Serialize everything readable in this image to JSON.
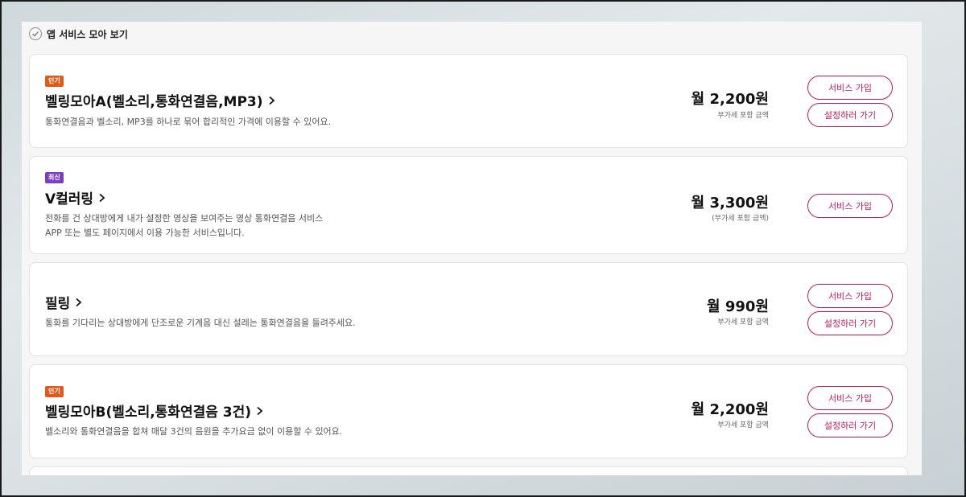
{
  "section": {
    "title": "앱 서비스 모아 보기"
  },
  "cards": [
    {
      "badge": "인기",
      "title": "벨링모아A(벨소리,통화연결음,MP3)",
      "desc1": "통화연결음과 벨소리, MP3를 하나로 묶어 합리적인 가격에 이용할 수 있어요.",
      "price": "월 2,200원",
      "vat": "부가세 포함 금액",
      "join_label": "서비스 가입",
      "settings_label": "설정하러 가기"
    },
    {
      "badge": "최신",
      "title": "V컬러링",
      "desc1": "전화를 건 상대방에게 내가 설정한 영상을 보여주는 영상 통화연결음 서비스",
      "desc2": "APP 또는 별도 페이지에서 이용 가능한 서비스입니다.",
      "price": "월 3,300원",
      "vat": "(부가세 포함 금액)",
      "join_label": "서비스 가입"
    },
    {
      "title": "필링",
      "desc1": "통화를 기다리는 상대방에게 단조로운 기계음 대신 설레는 통화연결음을 들려주세요.",
      "price": "월 990원",
      "vat": "부가세 포함 금액",
      "join_label": "서비스 가입",
      "settings_label": "설정하러 가기"
    },
    {
      "badge": "인기",
      "title": "벨링모아B(벨소리,통화연결음 3건)",
      "desc1": "벨소리와 통화연결음을 합쳐 매달 3건의 음원을 추가요금 없이 이용할 수 있어요.",
      "price": "월 2,200원",
      "vat": "부가세 포함 금액",
      "join_label": "서비스 가입",
      "settings_label": "설정하러 가기"
    }
  ],
  "colors": {
    "accent": "#c2185b",
    "badge_hot": "#e05a1c",
    "badge_new": "#7b3fc4"
  },
  "icons": {
    "section": "check-circle-icon",
    "title_arrow": "chevron-right-icon"
  }
}
